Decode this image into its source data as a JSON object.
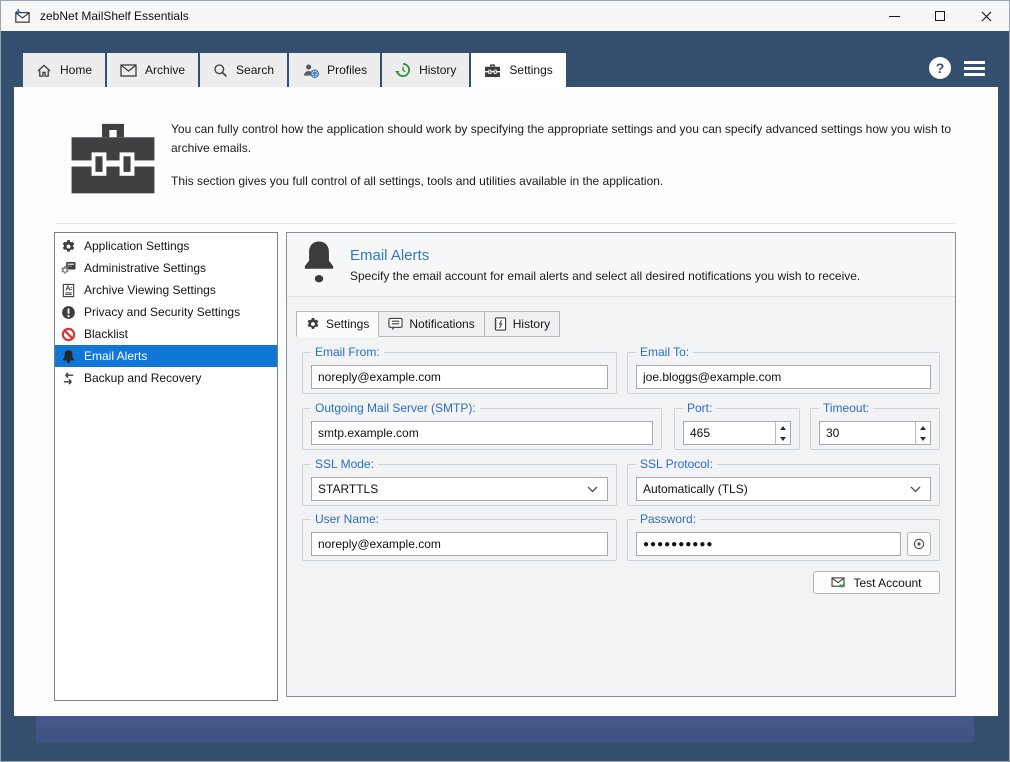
{
  "window": {
    "title": "zebNet MailShelf Essentials"
  },
  "titlebar_icons": {
    "help_glyph": "?"
  },
  "main_tabs": [
    {
      "label": "Home",
      "icon": "home-icon"
    },
    {
      "label": "Archive",
      "icon": "envelope-icon"
    },
    {
      "label": "Search",
      "icon": "magnifier-icon"
    },
    {
      "label": "Profiles",
      "icon": "person-globe-icon"
    },
    {
      "label": "History",
      "icon": "clock-arrow-icon"
    },
    {
      "label": "Settings",
      "icon": "toolbox-icon",
      "active": true
    }
  ],
  "header": {
    "paragraph1": "You can fully control how the application should work by specifying the appropriate settings and you can specify advanced settings how you wish to archive emails.",
    "paragraph2": "This section gives you full control of all settings, tools and utilities available in the application."
  },
  "sidebar": {
    "items": [
      {
        "label": "Application Settings",
        "icon": "gear-icon"
      },
      {
        "label": "Administrative Settings",
        "icon": "admin-gear-icon"
      },
      {
        "label": "Archive Viewing Settings",
        "icon": "document-a-icon"
      },
      {
        "label": "Privacy and Security Settings",
        "icon": "exclamation-circle-icon"
      },
      {
        "label": "Blacklist",
        "icon": "prohibition-icon"
      },
      {
        "label": "Email Alerts",
        "icon": "bell-icon",
        "selected": true
      },
      {
        "label": "Backup and Recovery",
        "icon": "sync-arrows-icon"
      }
    ]
  },
  "email_alerts": {
    "title": "Email Alerts",
    "description": "Specify the email account for email alerts and select all desired notifications you wish to receive.",
    "tabs": [
      {
        "label": "Settings",
        "icon": "gear-icon",
        "active": true
      },
      {
        "label": "Notifications",
        "icon": "speech-bubble-icon"
      },
      {
        "label": "History",
        "icon": "journal-icon"
      }
    ],
    "form": {
      "email_from": {
        "label": "Email From:",
        "value": "noreply@example.com"
      },
      "email_to": {
        "label": "Email To:",
        "value": "joe.bloggs@example.com"
      },
      "smtp_server": {
        "label": "Outgoing Mail Server (SMTP):",
        "value": "smtp.example.com"
      },
      "port": {
        "label": "Port:",
        "value": "465"
      },
      "timeout": {
        "label": "Timeout:",
        "value": "30"
      },
      "ssl_mode": {
        "label": "SSL Mode:",
        "value": "STARTTLS"
      },
      "ssl_protocol": {
        "label": "SSL Protocol:",
        "value": "Automatically (TLS)"
      },
      "user_name": {
        "label": "User Name:",
        "value": "noreply@example.com"
      },
      "password": {
        "label": "Password:",
        "masked_value": "●●●●●●●●●●"
      },
      "test_account_button": "Test Account"
    }
  },
  "colors": {
    "window_bg": "#35506f",
    "titlebar_bg": "#f8f7f7",
    "selection_blue": "#1177d7",
    "group_label_blue": "#2b6cc4",
    "panel_title_blue": "#3478ba",
    "blacklist_red": "#d23a3a",
    "history_green": "#2e8b35"
  }
}
